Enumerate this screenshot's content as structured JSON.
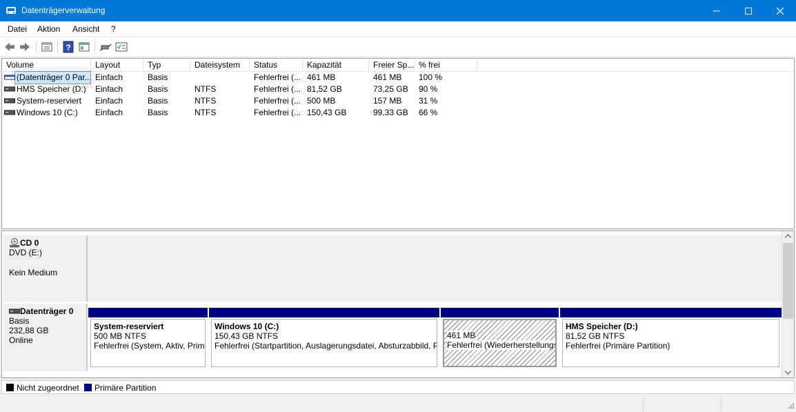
{
  "window": {
    "title": "Datenträgerverwaltung"
  },
  "menu": {
    "items": [
      "Datei",
      "Aktion",
      "Ansicht",
      "?"
    ]
  },
  "toolbar": {
    "icons": [
      "back-arrow-icon",
      "forward-arrow-icon",
      "properties-icon",
      "help-icon",
      "console-tree-icon",
      "connect-disk-icon",
      "check-list-icon"
    ]
  },
  "volume_list": {
    "columns": [
      "Volume",
      "Layout",
      "Typ",
      "Dateisystem",
      "Status",
      "Kapazität",
      "Freier Sp...",
      "% frei"
    ],
    "rows": [
      {
        "volume": "(Datenträger 0 Par...",
        "layout": "Einfach",
        "typ": "Basis",
        "fs": "",
        "status": "Fehlerfrei (...",
        "capacity": "461 MB",
        "free": "461 MB",
        "pct": "100 %",
        "selected": true
      },
      {
        "volume": "HMS Speicher (D:)",
        "layout": "Einfach",
        "typ": "Basis",
        "fs": "NTFS",
        "status": "Fehlerfrei (...",
        "capacity": "81,52 GB",
        "free": "73,25 GB",
        "pct": "90 %",
        "selected": false
      },
      {
        "volume": "System-reserviert",
        "layout": "Einfach",
        "typ": "Basis",
        "fs": "NTFS",
        "status": "Fehlerfrei (...",
        "capacity": "500 MB",
        "free": "157 MB",
        "pct": "31 %",
        "selected": false
      },
      {
        "volume": "Windows 10 (C:)",
        "layout": "Einfach",
        "typ": "Basis",
        "fs": "NTFS",
        "status": "Fehlerfrei (...",
        "capacity": "150,43 GB",
        "free": "99,33 GB",
        "pct": "66 %",
        "selected": false
      }
    ]
  },
  "disks": {
    "cd0": {
      "name": "CD 0",
      "line1": "DVD (E:)",
      "line2": "Kein Medium"
    },
    "disk0": {
      "name": "Datenträger 0",
      "type": "Basis",
      "size": "232,88 GB",
      "status": "Online",
      "partitions": [
        {
          "name": "System-reserviert",
          "size": "500 MB NTFS",
          "status": "Fehlerfrei (System, Aktiv, Prim"
        },
        {
          "name": "Windows 10  (C:)",
          "size": "150,43 GB NTFS",
          "status": "Fehlerfrei (Startpartition, Auslagerungsdatei, Absturzabbild, P"
        },
        {
          "name": "",
          "size": "461 MB",
          "status": "Fehlerfrei (Wiederherstellungs"
        },
        {
          "name": "HMS Speicher  (D:)",
          "size": "81,52 GB NTFS",
          "status": "Fehlerfrei (Primäre Partition)"
        }
      ]
    }
  },
  "legend": {
    "items": [
      {
        "label": "Nicht zugeordnet",
        "color": "#000000"
      },
      {
        "label": "Primäre Partition",
        "color": "#000080"
      }
    ]
  },
  "colors": {
    "titlebar": "#0078d7",
    "partition_bar": "#000080",
    "selection": "#cce8ff"
  }
}
